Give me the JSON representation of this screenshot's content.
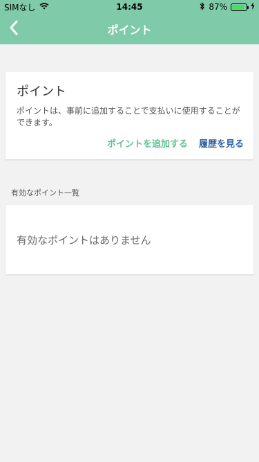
{
  "status": {
    "carrier": "SIMなし",
    "time": "14:45",
    "battery_percent": "87%",
    "battery_level": 0.87
  },
  "nav": {
    "title": "ポイント",
    "back_icon": "chevron-left-icon"
  },
  "points_card": {
    "title": "ポイント",
    "description": "ポイントは、事前に追加することで支払いに使用することができます。",
    "add_label": "ポイントを追加する",
    "history_label": "履歴を見る"
  },
  "valid_points": {
    "section_label": "有効なポイント一覧",
    "empty_text": "有効なポイントはありません"
  },
  "colors": {
    "header": "#7fcaa9",
    "add_link": "#61c18f",
    "history_link": "#2f5fa0",
    "background": "#f2f2f2"
  }
}
